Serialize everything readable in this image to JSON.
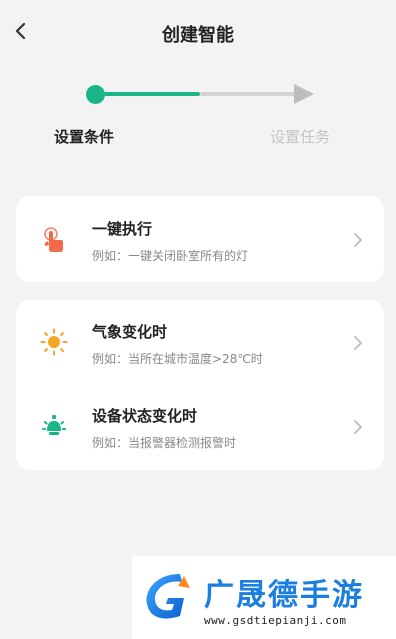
{
  "header": {
    "title": "创建智能"
  },
  "steps": {
    "step1_label": "设置条件",
    "step2_label": "设置任务",
    "active_color": "#1bb58a",
    "inactive_color": "#d3d3d3"
  },
  "conditions": [
    {
      "title": "一键执行",
      "subtitle": "例如：一键关闭卧室所有的灯",
      "icon": "tap-hand-icon"
    },
    {
      "title": "气象变化时",
      "subtitle": "例如：当所在城市温度>28℃时",
      "icon": "sun-icon"
    },
    {
      "title": "设备状态变化时",
      "subtitle": "例如：当报警器检测报警时",
      "icon": "device-bulb-icon"
    }
  ],
  "watermark": {
    "brand": "广晟德手游",
    "url": "www.gsdtiepianji.com"
  }
}
